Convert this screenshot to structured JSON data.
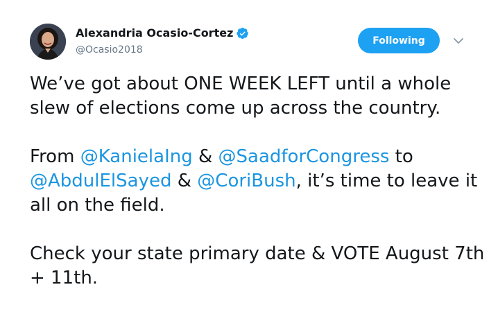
{
  "author": {
    "display_name": "Alexandria Ocasio-Cortez",
    "handle": "@Ocasio2018",
    "verified": true,
    "avatar_icon": "profile-photo"
  },
  "actions": {
    "follow_label": "Following",
    "caret_icon": "chevron-down-icon"
  },
  "colors": {
    "accent": "#1da1f2",
    "link": "#1b95e0",
    "text": "#14171a",
    "muted": "#657786"
  },
  "tweet": {
    "p1": "We’ve got about ONE WEEK LEFT until a whole slew of elections come up across the country.",
    "p2": {
      "t1": "From ",
      "m1": "@KanielaIng",
      "t2": " & ",
      "m2": "@SaadforCongress",
      "t3": " to ",
      "m3": "@AbdulElSayed",
      "t4": " & ",
      "m4": "@CoriBush",
      "t5": ", it’s time to leave it all on the field."
    },
    "p3": "Check your state primary date & VOTE August 7th + 11th."
  }
}
